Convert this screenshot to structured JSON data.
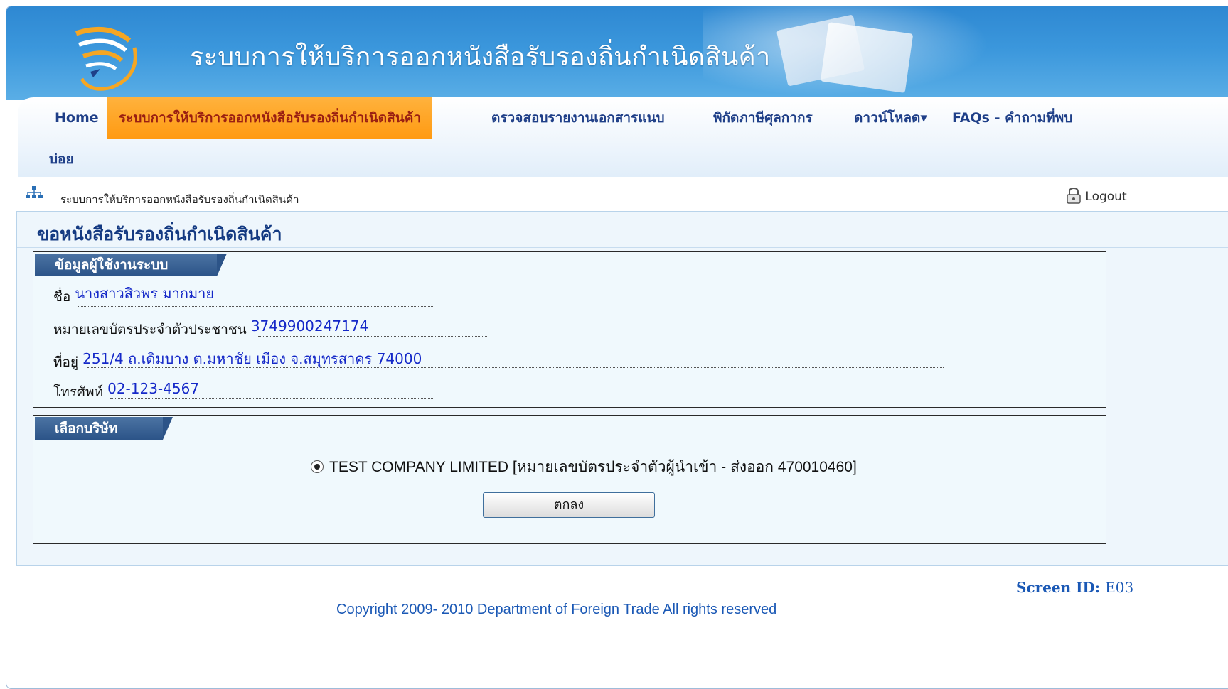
{
  "header": {
    "title": "ระบบการให้บริการออกหนังสือรับรองถิ่นกำเนิดสินค้า"
  },
  "nav": {
    "items": [
      {
        "label": "Home"
      },
      {
        "label": "ระบบการให้บริการออกหนังสือรับรองถิ่นกำเนิดสินค้า"
      },
      {
        "label": "ตรวจสอบรายงานเอกสารแนบ"
      },
      {
        "label": "พิกัดภาษีศุลกากร"
      },
      {
        "label": "ดาวน์โหลด▾"
      },
      {
        "label": "FAQs - คำถามที่พบ"
      }
    ],
    "faq_wrap": "บ่อย",
    "active_index": 1,
    "active_color": "#ff9f1c"
  },
  "breadcrumb": {
    "text": "ระบบการให้บริการออกหนังสือรับรองถิ่นกำเนิดสินค้า",
    "logout": "Logout"
  },
  "page": {
    "title": "ขอหนังสือรับรองถิ่นกำเนิดสินค้า"
  },
  "user_info": {
    "section_title": "ข้อมูลผู้ใช้งานระบบ",
    "name_label": "ชื่อ",
    "name_value": "นางสาวสิวพร มากมาย",
    "id_label": "หมายเลขบัตรประจำตัวประชาชน",
    "id_value": "3749900247174",
    "address_label": "ที่อยู่",
    "address_value": "251/4 ถ.เดิมบาง ต.มหาชัย เมือง จ.สมุทรสาคร 74000",
    "phone_label": "โทรศัพท์",
    "phone_value": "02-123-4567"
  },
  "company": {
    "section_title": "เลือกบริษัท",
    "option": "TEST COMPANY LIMITED [หมายเลขบัตรประจำตัวผู้นำเข้า - ส่งออก 470010460]",
    "selected": true,
    "ok_label": "ตกลง"
  },
  "footer": {
    "screen_id_label": "Screen ID:",
    "screen_id_value": "E03",
    "copyright": "Copyright 2009- 2010 Department of Foreign Trade All rights reserved"
  }
}
